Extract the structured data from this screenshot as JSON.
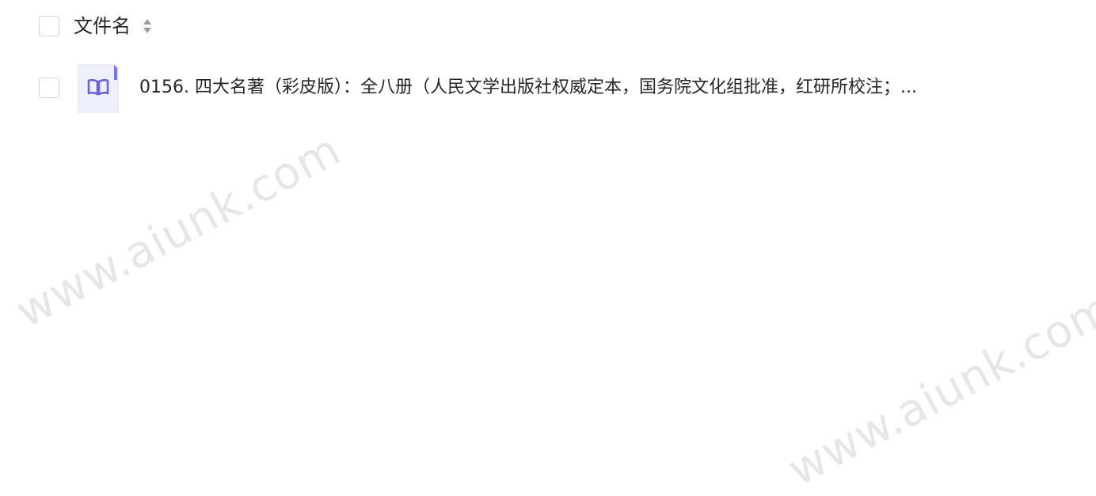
{
  "table": {
    "header": {
      "column_label": "文件名",
      "sort_icon": "sort-up-down-icon"
    },
    "rows": [
      {
        "icon": "book-file-icon",
        "name": "0156. 四大名著（彩皮版）：全八册（人民文学出版社权威定本，国务院文化组批准，红研所校注；..."
      }
    ]
  },
  "watermarks": [
    "www.aiunk.com",
    "www.aiunk.com"
  ],
  "colors": {
    "text": "#25262b",
    "checkbox_border": "#d2d4d9",
    "icon_bg": "#eef0fb",
    "icon_accent": "#6b63d6",
    "watermark": "#e6e6e6"
  }
}
